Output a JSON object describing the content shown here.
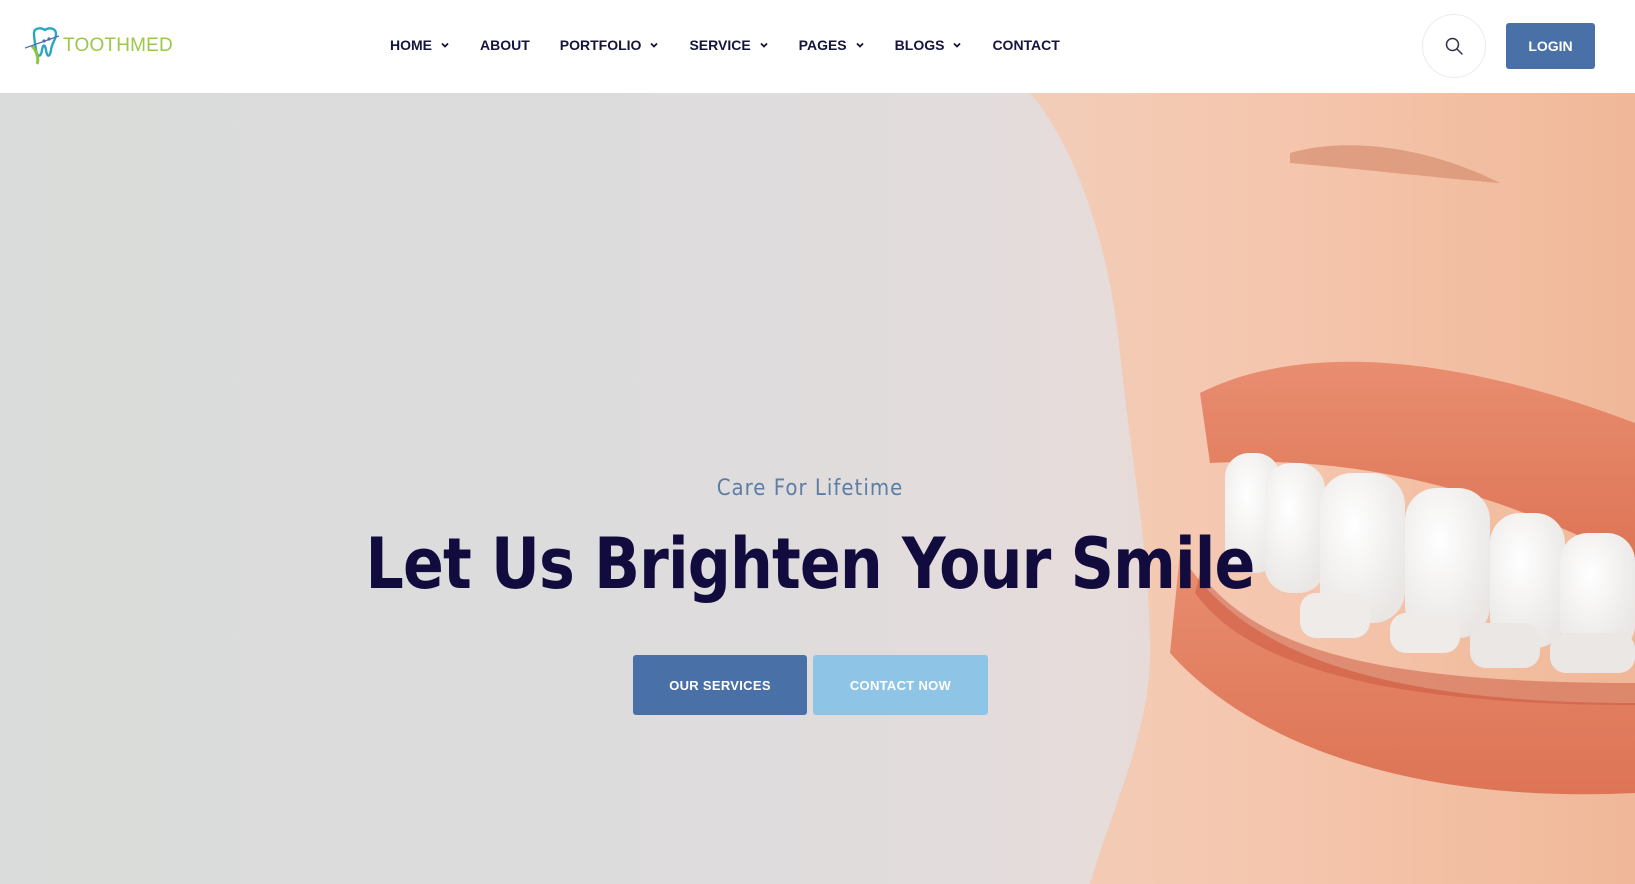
{
  "brand": {
    "name": "TOOTHMED",
    "logo_icon": "tooth-logo-icon"
  },
  "nav": {
    "items": [
      {
        "label": "HOME",
        "has_dropdown": true
      },
      {
        "label": "ABOUT",
        "has_dropdown": false
      },
      {
        "label": "PORTFOLIO",
        "has_dropdown": true
      },
      {
        "label": "SERVICE",
        "has_dropdown": true
      },
      {
        "label": "PAGES",
        "has_dropdown": true
      },
      {
        "label": "BLOGS",
        "has_dropdown": true
      },
      {
        "label": "CONTACT",
        "has_dropdown": false
      }
    ]
  },
  "header": {
    "search_icon": "search-icon",
    "login_label": "LOGIN"
  },
  "hero": {
    "subtitle": "Care For Lifetime",
    "title": "Let Us Brighten Your Smile",
    "primary_button": "OUR SERVICES",
    "secondary_button": "CONTACT NOW"
  },
  "colors": {
    "primary": "#4a70a8",
    "secondary": "#8ec5e6",
    "title": "#120c3e",
    "subtitle": "#5d7ea4",
    "logo": "#9cc74a"
  }
}
